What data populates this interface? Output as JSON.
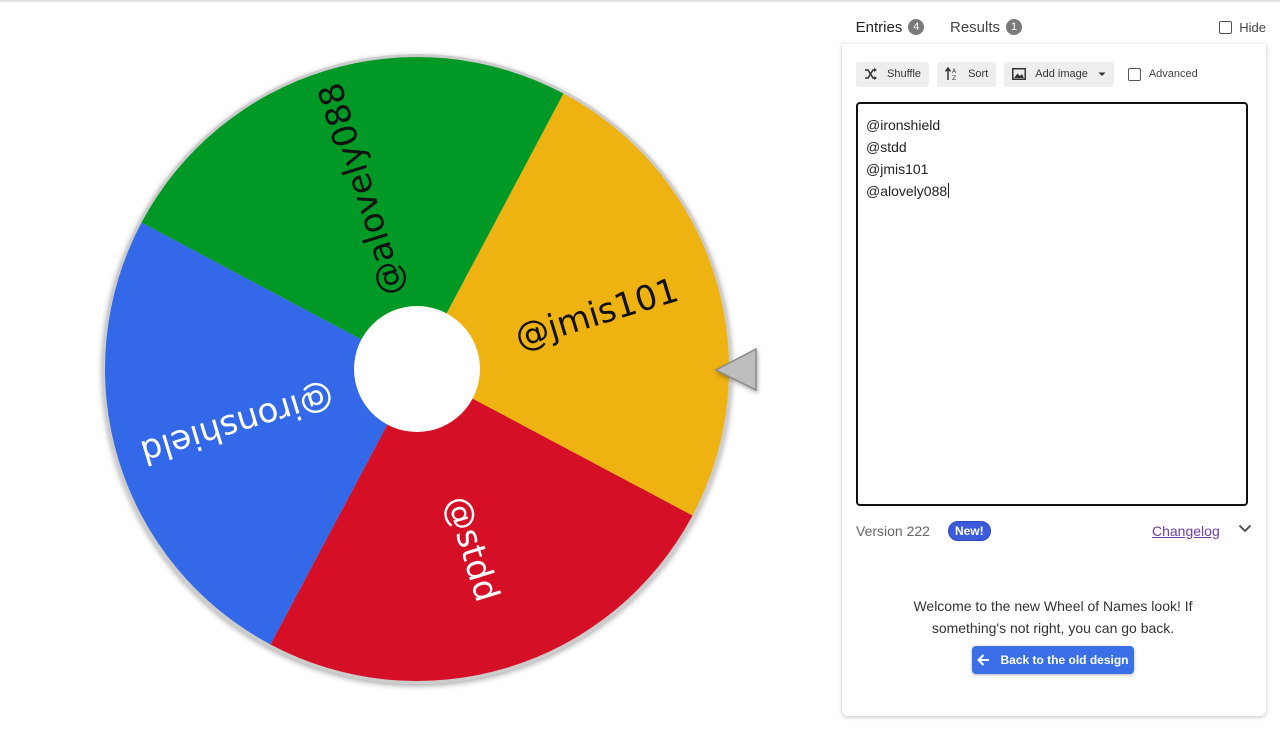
{
  "wheel": {
    "segments": [
      {
        "label": "@ironshield",
        "color": "#3369e8"
      },
      {
        "label": "@stdd",
        "color": "#d50f25"
      },
      {
        "label": "@jmis101",
        "color": "#eeb211"
      },
      {
        "label": "@alovely088",
        "color": "#009925"
      }
    ],
    "pointer_icon": "triangle-pointer"
  },
  "tabs": {
    "entries_label": "Entries",
    "entries_count": "4",
    "results_label": "Results",
    "results_count": "1"
  },
  "hide_label": "Hide",
  "toolbar": {
    "shuffle_label": "Shuffle",
    "sort_label": "Sort",
    "add_image_label": "Add image",
    "advanced_label": "Advanced"
  },
  "entries": [
    "@ironshield",
    "@stdd",
    "@jmis101",
    "@alovely088"
  ],
  "version": {
    "text": "Version 222",
    "new_badge": "New!",
    "changelog_label": "Changelog"
  },
  "welcome": {
    "line1": "Welcome to the new Wheel of Names look! If",
    "line2": "something's not right, you can go back.",
    "back_button": "Back to the old design"
  }
}
